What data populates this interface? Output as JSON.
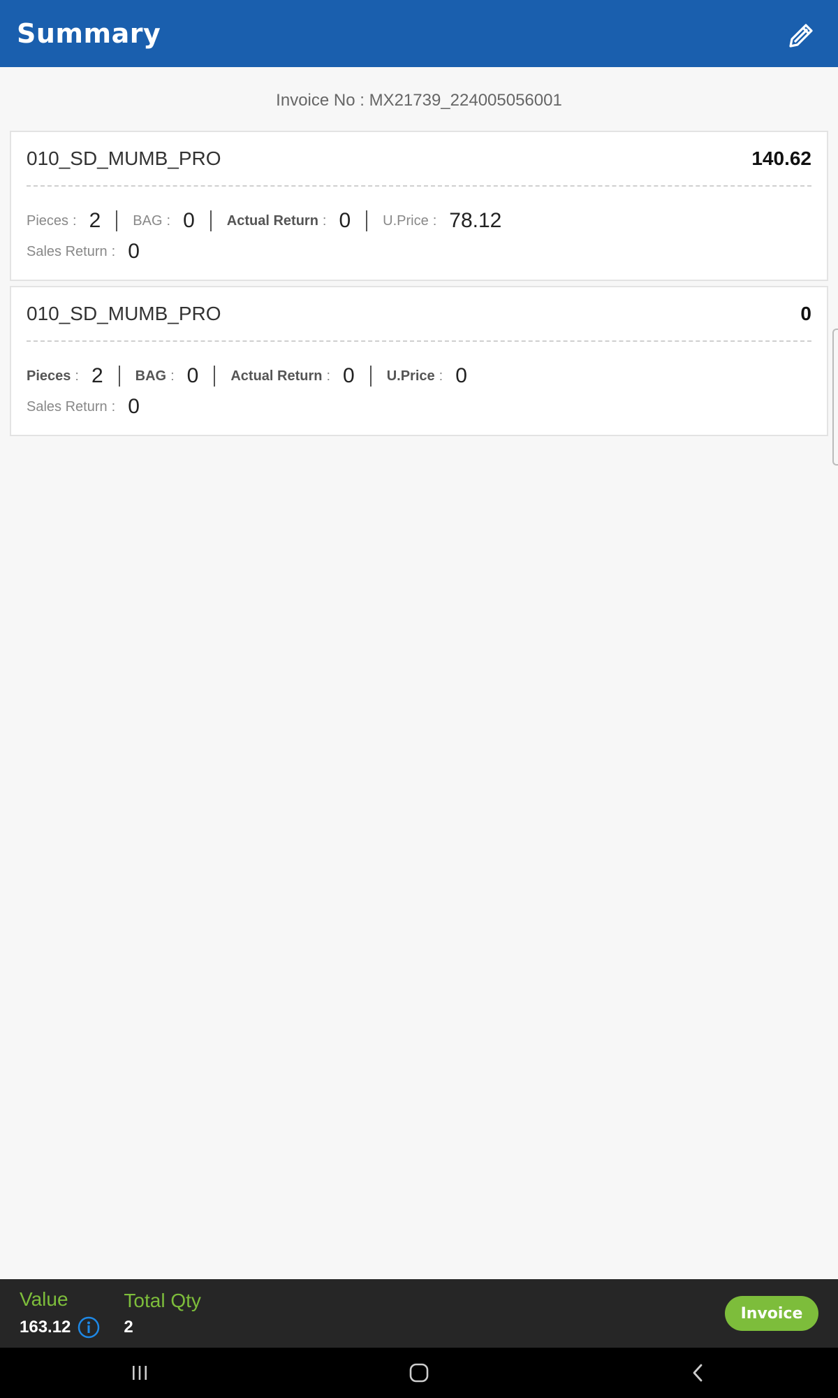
{
  "header": {
    "title": "Summary",
    "edit_icon": "edit-icon"
  },
  "invoice": {
    "label": "Invoice No : MX21739_224005056001"
  },
  "items": [
    {
      "name": "010_SD_MUMB_PRO",
      "amount": "140.62",
      "pieces_label": "Pieces",
      "pieces": "2",
      "bag_label": "BAG",
      "bag": "0",
      "actual_return_label": "Actual Return",
      "actual_return": "0",
      "uprice_label": "U.Price",
      "uprice": "78.12",
      "sales_return_label": "Sales Return",
      "sales_return": "0",
      "colon": ":"
    },
    {
      "name": "010_SD_MUMB_PRO",
      "amount": "0",
      "pieces_label": "Pieces",
      "pieces": "2",
      "bag_label": "BAG",
      "bag": "0",
      "actual_return_label": "Actual Return",
      "actual_return": "0",
      "uprice_label": "U.Price",
      "uprice": "0",
      "sales_return_label": "Sales Return",
      "sales_return": "0",
      "colon": ":"
    }
  ],
  "footer": {
    "value_label": "Value",
    "value": "163.12",
    "total_qty_label": "Total Qty",
    "total_qty": "2",
    "invoice_button": "Invoice",
    "colors": {
      "accent": "#7dbd3b",
      "bar": "#262626",
      "header": "#1a5fae",
      "info": "#1e88e5"
    }
  },
  "navigation": {
    "recent": "recent-apps-icon",
    "home": "home-icon",
    "back": "back-icon"
  }
}
